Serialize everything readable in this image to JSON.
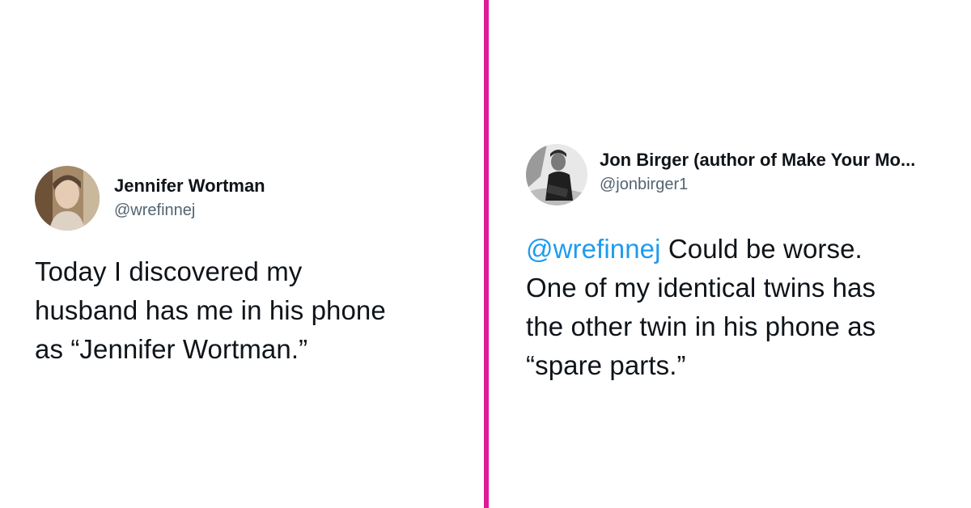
{
  "colors": {
    "divider": "#e0199a",
    "mention": "#1d9bf0",
    "text": "#0f1419",
    "handle": "#536471"
  },
  "tweets": [
    {
      "author": {
        "name": "Jennifer Wortman",
        "handle": "@wrefinnej",
        "avatar_icon": "profile-photo"
      },
      "lines": [
        "Today I discovered my",
        "husband has me in his phone",
        "as “Jennifer Wortman.”"
      ]
    },
    {
      "author": {
        "name": "Jon Birger (author of Make Your Mo...",
        "handle": "@jonbirger1",
        "avatar_icon": "profile-photo"
      },
      "mention": "@wrefinnej",
      "lines": [
        " Could be worse.",
        "One of my identical twins has",
        "the other twin in his phone as",
        "“spare parts.”"
      ]
    }
  ]
}
